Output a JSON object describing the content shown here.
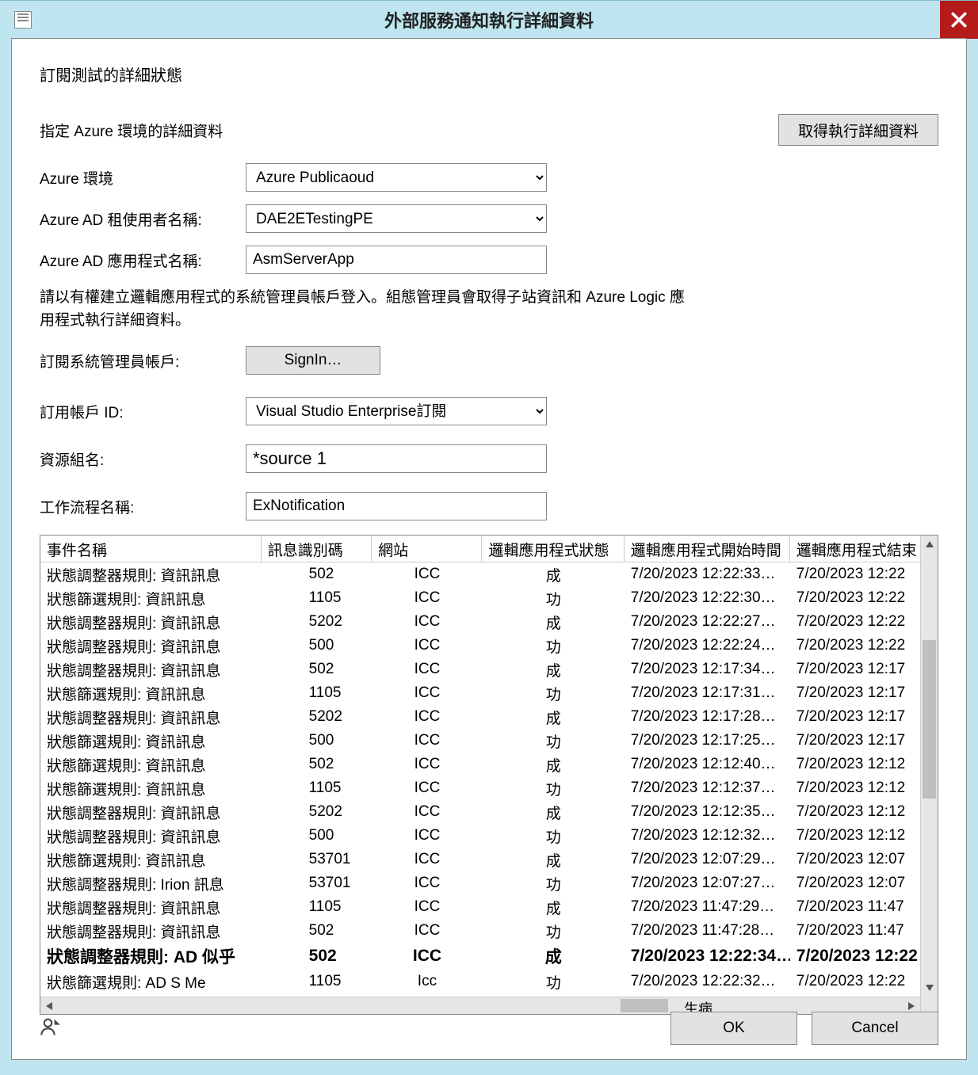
{
  "titlebar": {
    "title": "外部服務通知執行詳細資料"
  },
  "heading": "訂閱測試的詳細狀態",
  "section_label": "指定 Azure 環境的詳細資料",
  "get_details_btn": "取得執行詳細資料",
  "labels": {
    "azure_env": "Azure 環境",
    "tenant": "Azure AD 租使用者名稱:",
    "app": "Azure AD 應用程式名稱:",
    "admin": "訂閱系統管理員帳戶:",
    "sub_id": "訂用帳戶 ID:",
    "rg": "資源組名:",
    "wf": "工作流程名稱:"
  },
  "values": {
    "azure_env": "Azure Publicaoud",
    "tenant": "DAE2ETestingPE",
    "app": "AsmServerApp",
    "signin": "SignIn…",
    "sub_id": "Visual Studio Enterprise訂閱",
    "rg": "*source 1",
    "wf": "ExNotification"
  },
  "hint": "請以有權建立邏輯應用程式的系統管理員帳戶登入。組態管理員會取得子站資訊和 Azure Logic 應用程式執行詳細資料。",
  "grid": {
    "headers": [
      "事件名稱",
      "訊息識別碼",
      "網站",
      "邏輯應用程式狀態",
      "邏輯應用程式開始時間",
      "邏輯應用程式結束"
    ],
    "rows": [
      {
        "c": [
          "狀態調整器規則: 資訊訊息",
          "502",
          "ICC",
          "成",
          "7/20/2023 12:22:33…",
          "7/20/2023 12:22"
        ]
      },
      {
        "c": [
          "狀態篩選規則: 資訊訊息",
          "1105",
          "ICC",
          "功",
          "7/20/2023 12:22:30…",
          "7/20/2023 12:22"
        ]
      },
      {
        "c": [
          "狀態調整器規則: 資訊訊息",
          "5202",
          "ICC",
          "成",
          "7/20/2023 12:22:27…",
          "7/20/2023 12:22"
        ]
      },
      {
        "c": [
          "狀態調整器規則: 資訊訊息",
          "500",
          "ICC",
          "功",
          "7/20/2023 12:22:24…",
          "7/20/2023 12:22"
        ]
      },
      {
        "c": [
          "狀態調整器規則: 資訊訊息",
          "502",
          "ICC",
          "成",
          "7/20/2023 12:17:34…",
          "7/20/2023 12:17"
        ]
      },
      {
        "c": [
          "狀態篩選規則: 資訊訊息",
          "1105",
          "ICC",
          "功",
          "7/20/2023 12:17:31…",
          "7/20/2023 12:17"
        ]
      },
      {
        "c": [
          "狀態調整器規則: 資訊訊息",
          "5202",
          "ICC",
          "成",
          "7/20/2023 12:17:28…",
          "7/20/2023 12:17"
        ]
      },
      {
        "c": [
          "狀態篩選規則: 資訊訊息",
          "500",
          "ICC",
          "功",
          "7/20/2023 12:17:25…",
          "7/20/2023 12:17"
        ]
      },
      {
        "c": [
          "狀態篩選規則: 資訊訊息",
          "502",
          "ICC",
          "成",
          "7/20/2023 12:12:40…",
          "7/20/2023 12:12"
        ]
      },
      {
        "c": [
          "狀態篩選規則: 資訊訊息",
          "1105",
          "ICC",
          "功",
          "7/20/2023 12:12:37…",
          "7/20/2023 12:12"
        ]
      },
      {
        "c": [
          "狀態調整器規則: 資訊訊息",
          "5202",
          "ICC",
          "成",
          "7/20/2023 12:12:35…",
          "7/20/2023 12:12"
        ]
      },
      {
        "c": [
          "狀態調整器規則: 資訊訊息",
          "500",
          "ICC",
          "功",
          "7/20/2023 12:12:32…",
          "7/20/2023 12:12"
        ]
      },
      {
        "c": [
          "狀態篩選規則: 資訊訊息",
          "53701",
          "ICC",
          "成",
          "7/20/2023 12:07:29…",
          "7/20/2023 12:07"
        ]
      },
      {
        "c": [
          "狀態調整器規則: Irion 訊息",
          "53701",
          "ICC",
          "功",
          "7/20/2023 12:07:27…",
          "7/20/2023 12:07"
        ]
      },
      {
        "c": [
          "狀態調整器規則: 資訊訊息",
          "1105",
          "ICC",
          "成",
          "7/20/2023 11:47:29…",
          "7/20/2023 11:47"
        ]
      },
      {
        "c": [
          "狀態調整器規則: 資訊訊息",
          "502",
          "ICC",
          "功",
          "7/20/2023 11:47:28…",
          "7/20/2023 11:47"
        ]
      },
      {
        "c": [
          "狀態調整器規則: AD 似乎",
          "502",
          "ICC",
          "成",
          "7/20/2023 12:22:34…",
          "7/20/2023 12:22"
        ],
        "bold": true
      },
      {
        "c": [
          "狀態篩選規則: AD S Me",
          "1105",
          "Icc",
          "功",
          "7/20/2023 12:22:32…",
          "7/20/2023 12:22"
        ]
      }
    ],
    "hlabel": "生病"
  },
  "footer": {
    "ok": "OK",
    "cancel": "Cancel"
  }
}
